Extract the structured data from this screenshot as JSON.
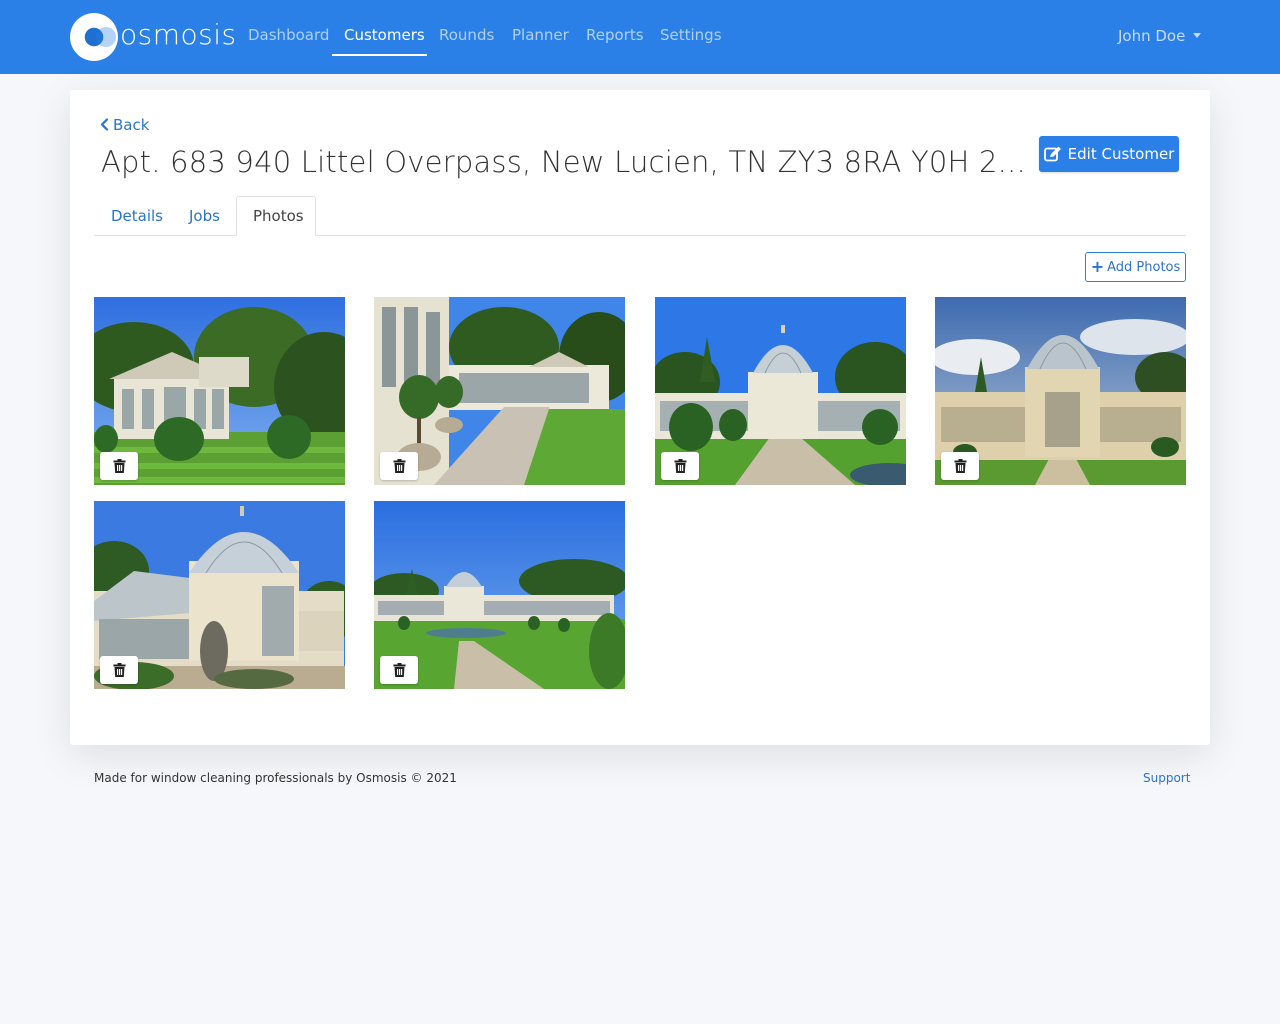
{
  "brand": {
    "name": "osmosis"
  },
  "nav": {
    "items": [
      {
        "label": "Dashboard"
      },
      {
        "label": "Customers"
      },
      {
        "label": "Rounds"
      },
      {
        "label": "Planner"
      },
      {
        "label": "Reports"
      },
      {
        "label": "Settings"
      }
    ],
    "active": "Customers",
    "user": "John Doe"
  },
  "page": {
    "back_label": "Back",
    "title": "Apt. 683 940 Littel Overpass, New Lucien, TN ZY3 8RA Y0H 2...",
    "edit_label": "Edit Customer"
  },
  "tabs": [
    {
      "label": "Details"
    },
    {
      "label": "Jobs"
    },
    {
      "label": "Photos"
    }
  ],
  "active_tab": "Photos",
  "photos": {
    "add_label": "Add Photos",
    "items": [
      {
        "subject": "conservatory-pavilion-lawn"
      },
      {
        "subject": "conservatory-terrace-path"
      },
      {
        "subject": "domed-conservatory-front"
      },
      {
        "subject": "domed-conservatory-cloudy"
      },
      {
        "subject": "domed-conservatory-angle"
      },
      {
        "subject": "domed-conservatory-distant"
      }
    ]
  },
  "footer": {
    "text": "Made for window cleaning professionals by Osmosis © 2021",
    "support_label": "Support"
  },
  "colors": {
    "primary": "#2a80e6",
    "link": "#2a74c9",
    "background": "#f6f7fa"
  },
  "icons": {
    "edit": "edit-icon",
    "back": "chevron-left-icon",
    "add": "plus-icon",
    "delete": "trash-icon",
    "dropdown": "caret-down-icon"
  }
}
